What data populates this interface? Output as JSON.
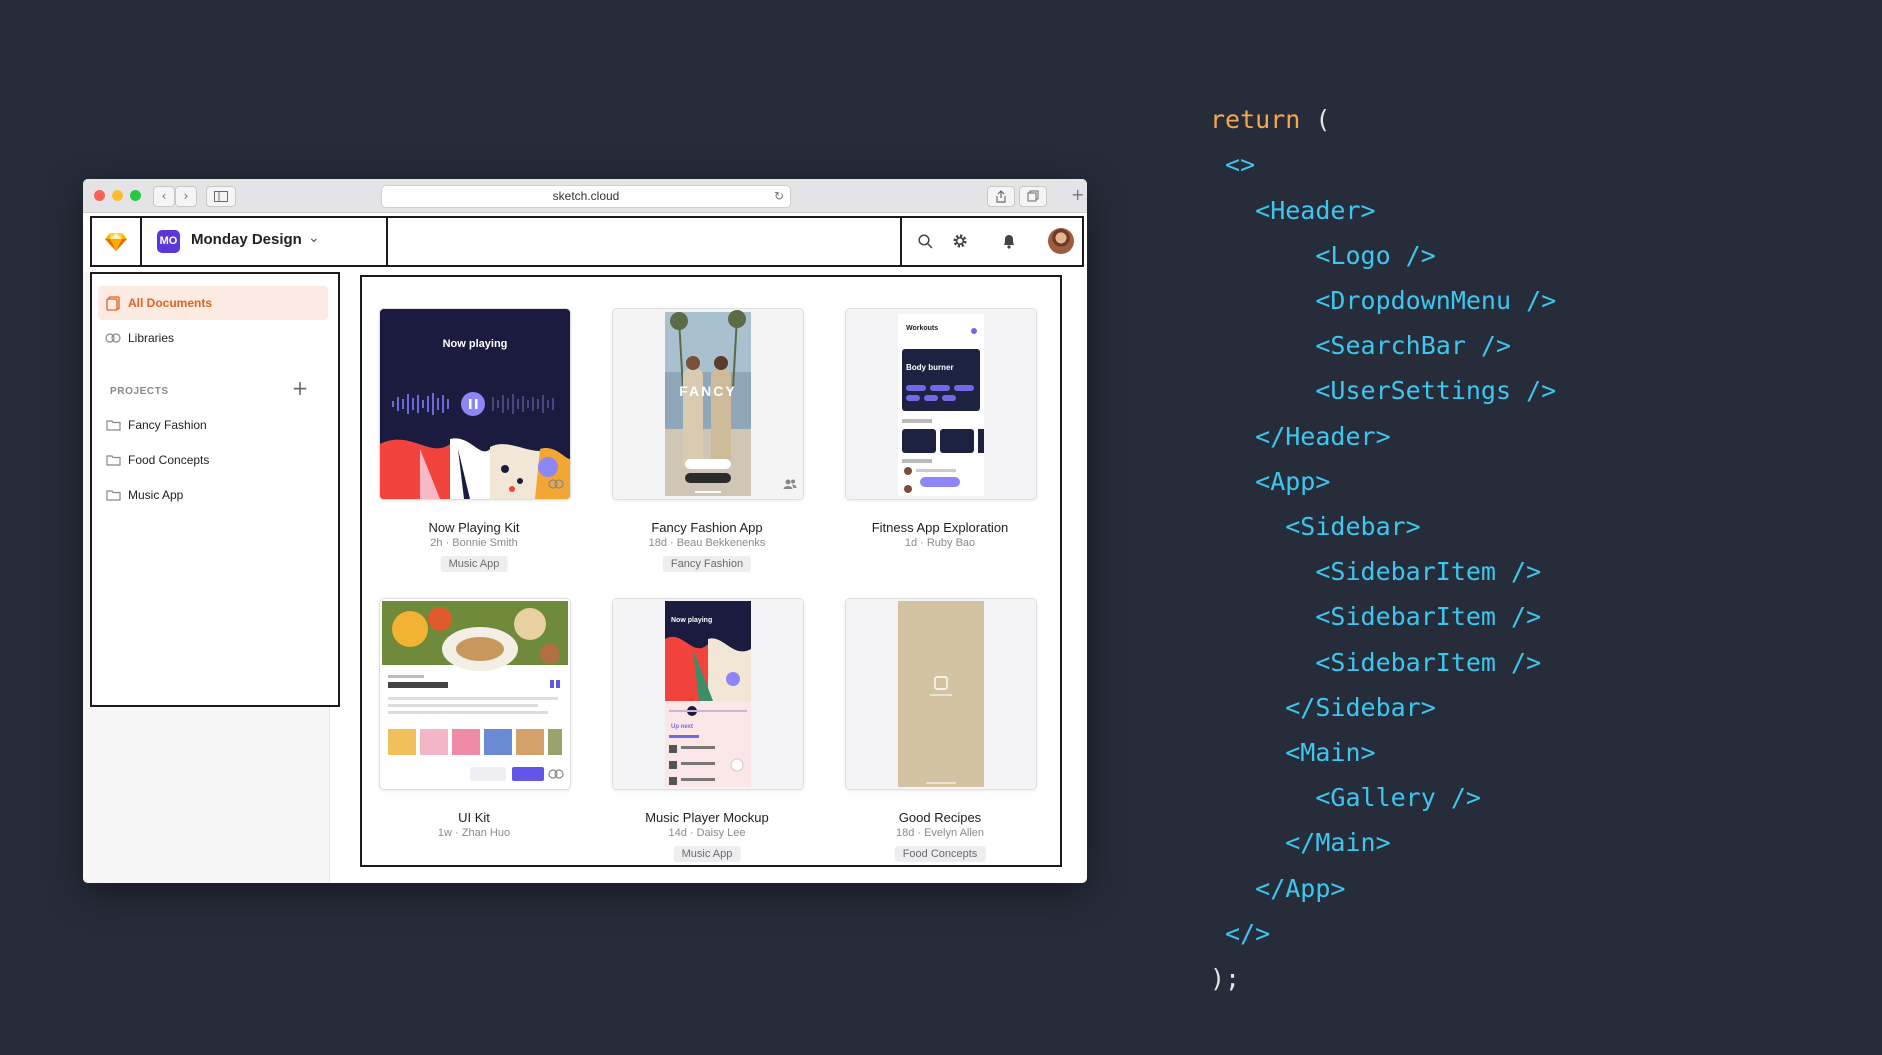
{
  "browser": {
    "url": "sketch.cloud"
  },
  "header": {
    "workspace_badge": "MO",
    "workspace_name": "Monday Design"
  },
  "sidebar": {
    "items": [
      {
        "label": "All Documents",
        "active": true,
        "icon": "documents-icon"
      },
      {
        "label": "Libraries",
        "active": false,
        "icon": "libraries-icon"
      }
    ],
    "projects_label": "PROJECTS",
    "projects": [
      {
        "label": "Fancy Fashion",
        "icon": "folder-icon"
      },
      {
        "label": "Food Concepts",
        "icon": "folder-icon"
      },
      {
        "label": "Music App",
        "icon": "folder-icon"
      }
    ]
  },
  "gallery": {
    "cards": [
      {
        "title": "Now Playing Kit",
        "meta": "2h · Bonnie Smith",
        "tag": "Music App",
        "thumb_text": "Now playing"
      },
      {
        "title": "Fancy Fashion App",
        "meta": "18d · Beau Bekkenenks",
        "tag": "Fancy Fashion",
        "thumb_text": "FANCY"
      },
      {
        "title": "Fitness App Exploration",
        "meta": "1d · Ruby Bao",
        "tag": "",
        "thumb_text": "Workouts",
        "thumb_sub": "Body burner"
      },
      {
        "title": "UI Kit",
        "meta": "1w · Zhan Huo",
        "tag": ""
      },
      {
        "title": "Music Player Mockup",
        "meta": "14d · Daisy Lee",
        "tag": "Music App",
        "thumb_text": "Now playing",
        "thumb_sub": "Up next"
      },
      {
        "title": "Good Recipes",
        "meta": "18d · Evelyn Allen",
        "tag": "Food Concepts"
      }
    ]
  },
  "code": {
    "lines": [
      "return (",
      " <>",
      "   <Header>",
      "       <Logo />",
      "       <DropdownMenu />",
      "       <SearchBar />",
      "       <UserSettings />",
      "   </Header>",
      "   <App>",
      "     <Sidebar>",
      "       <SidebarItem />",
      "       <SidebarItem />",
      "       <SidebarItem />",
      "     </Sidebar>",
      "     <Main>",
      "       <Gallery />",
      "     </Main>",
      "   </App>",
      " </>",
      ");"
    ]
  },
  "colors": {
    "background": "#262c3a",
    "code_tag": "#3ec7ee",
    "code_keyword": "#f4a84b",
    "active_item": "#e06320",
    "workspace_badge": "#5b37d8"
  }
}
